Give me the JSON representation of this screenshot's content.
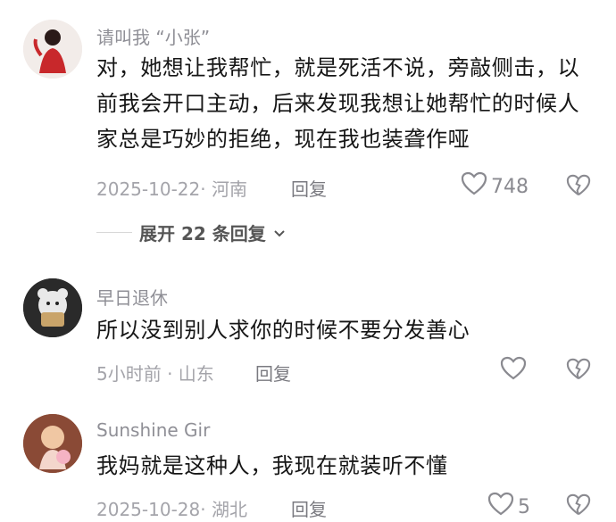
{
  "comments": [
    {
      "username": "请叫我 “小张”",
      "text": "对，她想让我帮忙，就是死活不说，旁敲侧击，以前我会开口主动，后来发现我想让她帮忙的时候人家总是巧妙的拒绝，现在我也装聋作哑",
      "meta": "2025-10-22· 河南",
      "reply_label": "回复",
      "like_count": "748",
      "expand_label": "展开 22 条回复"
    },
    {
      "username": "早日退休",
      "text": "所以没到别人求你的时候不要分发善心",
      "meta": "5小时前 · 山东",
      "reply_label": "回复",
      "like_count": ""
    },
    {
      "username": "Sunshine Gir",
      "text": "我妈就是这种人，我现在就装听不懂",
      "meta": "2025-10-28· 湖北",
      "reply_label": "回复",
      "like_count": "5"
    }
  ]
}
